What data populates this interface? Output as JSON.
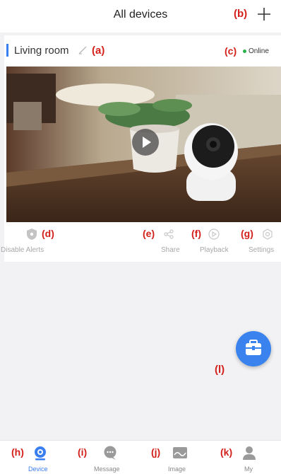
{
  "header": {
    "title": "All devices",
    "annotation": "(b)"
  },
  "device": {
    "name": "Living room",
    "name_annotation": "(a)",
    "status": "Online",
    "status_annotation": "(c)",
    "status_color": "#29b24a"
  },
  "actions": [
    {
      "label": "Disable Alerts",
      "annotation": "(d)",
      "icon": "shield-icon"
    },
    {
      "label": "Share",
      "annotation": "(e)",
      "icon": "share-icon"
    },
    {
      "label": "Playback",
      "annotation": "(f)",
      "icon": "playback-icon"
    },
    {
      "label": "Settings",
      "annotation": "(g)",
      "icon": "settings-icon"
    }
  ],
  "fab": {
    "annotation": "(l)",
    "icon": "toolbox-icon"
  },
  "tabs": [
    {
      "label": "Device",
      "annotation": "(h)",
      "icon": "camera-icon",
      "active": true
    },
    {
      "label": "Message",
      "annotation": "(i)",
      "icon": "chat-icon",
      "active": false
    },
    {
      "label": "Image",
      "annotation": "(j)",
      "icon": "image-icon",
      "active": false
    },
    {
      "label": "My",
      "annotation": "(k)",
      "icon": "person-icon",
      "active": false
    }
  ],
  "colors": {
    "accent": "#3a7ff0",
    "annotation": "#d4201a",
    "background": "#f2f2f4"
  }
}
